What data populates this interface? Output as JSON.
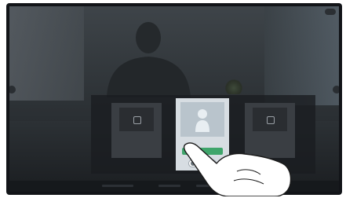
{
  "app": {
    "title": ""
  },
  "overlay": {
    "cards": [
      {
        "name": "",
        "sub": ""
      },
      {
        "name": "",
        "call_label": ""
      },
      {
        "name": "",
        "sub": ""
      }
    ]
  },
  "colors": {
    "accent": "#3fa56b",
    "highlight_card": "#d7dde2",
    "panel": "#191c20"
  },
  "icons": {
    "card_1": "screen-icon",
    "card_3": "screen-icon",
    "avatar": "person-icon"
  }
}
